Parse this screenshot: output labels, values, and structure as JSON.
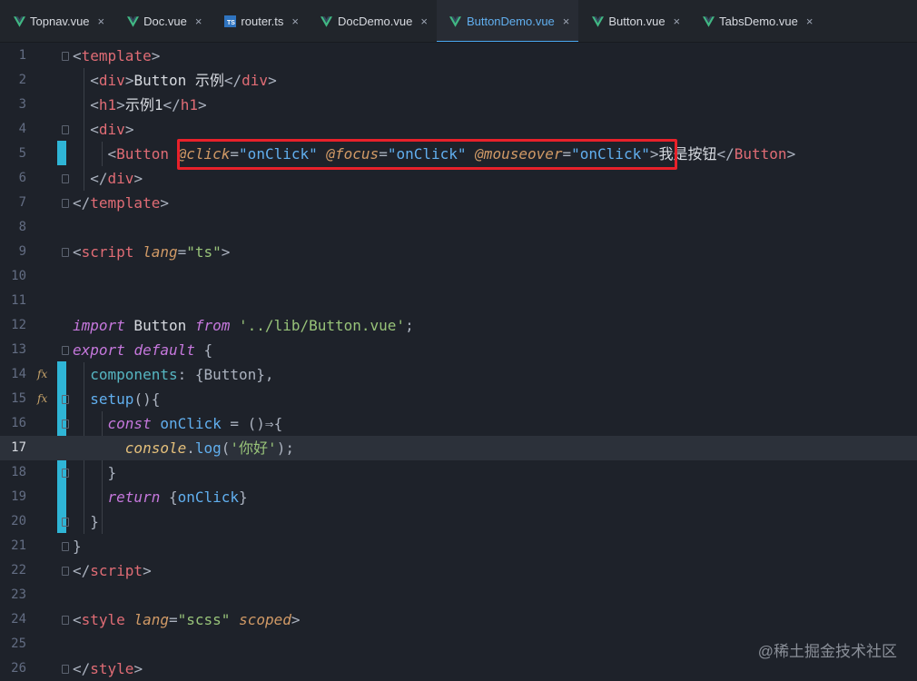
{
  "tabs": [
    {
      "label": "Topnav.vue",
      "icon": "vue-icon",
      "active": false
    },
    {
      "label": "Doc.vue",
      "icon": "vue-icon",
      "active": false
    },
    {
      "label": "router.ts",
      "icon": "typescript-icon",
      "active": false
    },
    {
      "label": "DocDemo.vue",
      "icon": "vue-icon",
      "active": false
    },
    {
      "label": "ButtonDemo.vue",
      "icon": "vue-icon",
      "active": true
    },
    {
      "label": "Button.vue",
      "icon": "vue-icon",
      "active": false
    },
    {
      "label": "TabsDemo.vue",
      "icon": "vue-icon",
      "active": false
    }
  ],
  "tab_close_glyph": "×",
  "ts_badge": "TS",
  "editor": {
    "current_line": 17,
    "line_numbers": [
      "1",
      "2",
      "3",
      "4",
      "5",
      "6",
      "7",
      "8",
      "9",
      "10",
      "11",
      "12",
      "13",
      "14",
      "15",
      "16",
      "17",
      "18",
      "19",
      "20",
      "21",
      "22",
      "23",
      "24",
      "25",
      "26"
    ],
    "lines": [
      [
        {
          "t": "<",
          "c": "punc"
        },
        {
          "t": "template",
          "c": "tag"
        },
        {
          "t": ">",
          "c": "punc"
        }
      ],
      [
        {
          "t": "  <",
          "c": "punc"
        },
        {
          "t": "div",
          "c": "tag"
        },
        {
          "t": ">",
          "c": "punc"
        },
        {
          "t": "Button 示例",
          "c": "txt"
        },
        {
          "t": "</",
          "c": "punc"
        },
        {
          "t": "div",
          "c": "tag"
        },
        {
          "t": ">",
          "c": "punc"
        }
      ],
      [
        {
          "t": "  <",
          "c": "punc"
        },
        {
          "t": "h1",
          "c": "tag"
        },
        {
          "t": ">",
          "c": "punc"
        },
        {
          "t": "示例1",
          "c": "txt"
        },
        {
          "t": "</",
          "c": "punc"
        },
        {
          "t": "h1",
          "c": "tag"
        },
        {
          "t": ">",
          "c": "punc"
        }
      ],
      [
        {
          "t": "  <",
          "c": "punc"
        },
        {
          "t": "div",
          "c": "tag"
        },
        {
          "t": ">",
          "c": "punc"
        }
      ],
      [
        {
          "t": "    <",
          "c": "punc"
        },
        {
          "t": "Button",
          "c": "tag"
        },
        {
          "t": " ",
          "c": "punc"
        },
        {
          "t": "@click",
          "c": "ev"
        },
        {
          "t": "=",
          "c": "punc"
        },
        {
          "t": "\"onClick\"",
          "c": "evv"
        },
        {
          "t": " ",
          "c": "punc"
        },
        {
          "t": "@focus",
          "c": "ev"
        },
        {
          "t": "=",
          "c": "punc"
        },
        {
          "t": "\"onClick\"",
          "c": "evv"
        },
        {
          "t": " ",
          "c": "punc"
        },
        {
          "t": "@mouseover",
          "c": "ev"
        },
        {
          "t": "=",
          "c": "punc"
        },
        {
          "t": "\"onClick\"",
          "c": "evv"
        },
        {
          "t": ">",
          "c": "punc"
        },
        {
          "t": "我是按钮",
          "c": "txt"
        },
        {
          "t": "</",
          "c": "punc"
        },
        {
          "t": "Button",
          "c": "tag"
        },
        {
          "t": ">",
          "c": "punc"
        }
      ],
      [
        {
          "t": "  </",
          "c": "punc"
        },
        {
          "t": "div",
          "c": "tag"
        },
        {
          "t": ">",
          "c": "punc"
        }
      ],
      [
        {
          "t": "</",
          "c": "punc"
        },
        {
          "t": "template",
          "c": "tag"
        },
        {
          "t": ">",
          "c": "punc"
        }
      ],
      [],
      [
        {
          "t": "<",
          "c": "punc"
        },
        {
          "t": "script",
          "c": "tag"
        },
        {
          "t": " ",
          "c": "punc"
        },
        {
          "t": "lang",
          "c": "attr"
        },
        {
          "t": "=",
          "c": "punc"
        },
        {
          "t": "\"ts\"",
          "c": "str"
        },
        {
          "t": ">",
          "c": "punc"
        }
      ],
      [],
      [],
      [
        {
          "t": "import",
          "c": "key"
        },
        {
          "t": " Button ",
          "c": "txt"
        },
        {
          "t": "from",
          "c": "key"
        },
        {
          "t": " ",
          "c": "punc"
        },
        {
          "t": "'../lib/Button.vue'",
          "c": "str"
        },
        {
          "t": ";",
          "c": "punc"
        }
      ],
      [
        {
          "t": "export",
          "c": "key"
        },
        {
          "t": " ",
          "c": "punc"
        },
        {
          "t": "default",
          "c": "key"
        },
        {
          "t": " {",
          "c": "punc"
        }
      ],
      [
        {
          "t": "  components",
          "c": "prop"
        },
        {
          "t": ": {Button},",
          "c": "punc"
        }
      ],
      [
        {
          "t": "  setup",
          "c": "fn"
        },
        {
          "t": "(){",
          "c": "punc"
        }
      ],
      [
        {
          "t": "    const",
          "c": "key"
        },
        {
          "t": " onClick",
          "c": "fn"
        },
        {
          "t": " = ()⇒{",
          "c": "punc"
        }
      ],
      [
        {
          "t": "      console",
          "c": "var"
        },
        {
          "t": ".",
          "c": "punc"
        },
        {
          "t": "log",
          "c": "fn"
        },
        {
          "t": "(",
          "c": "punc"
        },
        {
          "t": "'你好'",
          "c": "str"
        },
        {
          "t": ");",
          "c": "punc"
        }
      ],
      [
        {
          "t": "    }",
          "c": "punc"
        }
      ],
      [
        {
          "t": "    return",
          "c": "key"
        },
        {
          "t": " {",
          "c": "punc"
        },
        {
          "t": "onClick",
          "c": "fn"
        },
        {
          "t": "}",
          "c": "punc"
        }
      ],
      [
        {
          "t": "  }",
          "c": "punc"
        }
      ],
      [
        {
          "t": "}",
          "c": "punc"
        }
      ],
      [
        {
          "t": "</",
          "c": "punc"
        },
        {
          "t": "script",
          "c": "tag"
        },
        {
          "t": ">",
          "c": "punc"
        }
      ],
      [],
      [
        {
          "t": "<",
          "c": "punc"
        },
        {
          "t": "style",
          "c": "tag"
        },
        {
          "t": " ",
          "c": "punc"
        },
        {
          "t": "lang",
          "c": "attr"
        },
        {
          "t": "=",
          "c": "punc"
        },
        {
          "t": "\"scss\"",
          "c": "str"
        },
        {
          "t": " ",
          "c": "punc"
        },
        {
          "t": "scoped",
          "c": "attr"
        },
        {
          "t": ">",
          "c": "punc"
        }
      ],
      [],
      [
        {
          "t": "</",
          "c": "punc"
        },
        {
          "t": "style",
          "c": "tag"
        },
        {
          "t": ">",
          "c": "punc"
        }
      ]
    ],
    "gutter_fx_lines": [
      14,
      15
    ],
    "gutter_fx_glyph": "𝑓x"
  },
  "colors": {
    "highlight_box": "#e8212a",
    "active_tab_accent": "#4aa8f0",
    "change_bar": "#2fb5d6"
  },
  "watermark": "@稀土掘金技术社区"
}
